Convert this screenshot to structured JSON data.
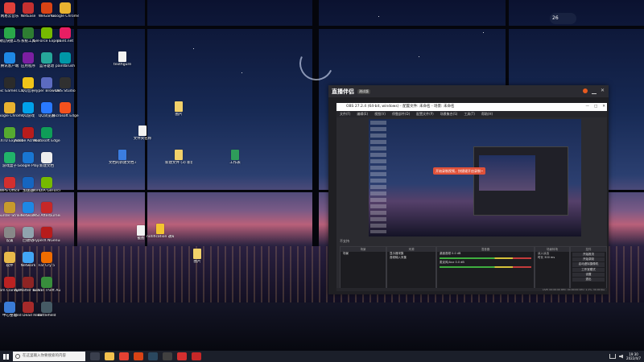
{
  "desktop": {
    "icons_col1": [
      {
        "label": "网易云音乐",
        "color": "#e0403a"
      },
      {
        "label": "微信快捷工作",
        "color": "#2aa84a"
      },
      {
        "label": "腾讯客户端",
        "color": "#1e88e5"
      },
      {
        "label": "Epic Games Launcher",
        "color": "#2b2b2b"
      },
      {
        "label": "Google Chrome",
        "color": "#e8b230"
      },
      {
        "label": "TEXTU Explorer",
        "color": "#55aa30"
      },
      {
        "label": "游戏盒子",
        "color": "#21b36a"
      },
      {
        "label": "WPS Office",
        "color": "#d32f2f"
      },
      {
        "label": "Counter-Strike Global Off...",
        "color": "#c79a2d"
      },
      {
        "label": "设置",
        "color": "#888888"
      },
      {
        "label": "软件",
        "color": "#e8b94a"
      },
      {
        "label": "Tom Clancy's",
        "color": "#b22"
      },
      {
        "label": "中心整理",
        "color": "#3a7bd5"
      }
    ],
    "icons_col2": [
      {
        "label": "NetEase",
        "color": "#c53030"
      },
      {
        "label": "系统工具",
        "color": "#2e7d32"
      },
      {
        "label": "应用程序",
        "color": "#7b1fa2"
      },
      {
        "label": "QQ音乐",
        "color": "#f0c419"
      },
      {
        "label": "QQ游戏",
        "color": "#00a0e9"
      },
      {
        "label": "Adobe Acrobat DC",
        "color": "#b71c1c"
      },
      {
        "label": "Google Play",
        "color": "#1976d2"
      },
      {
        "label": "加速器",
        "color": "#1565c0"
      },
      {
        "label": "Network",
        "color": "#1e88e5"
      },
      {
        "label": "回收站",
        "color": "#90a4ae"
      },
      {
        "label": "Network",
        "color": "#42a5f5"
      },
      {
        "label": "NoMatter BLADERO...",
        "color": "#8e2424"
      },
      {
        "label": "Red Dead Redemptio...",
        "color": "#a52a2a"
      }
    ],
    "icons_col3": [
      {
        "label": "WeGame",
        "color": "#d84315"
      },
      {
        "label": "GeForce Experience",
        "color": "#76b900"
      },
      {
        "label": "蓝牙驱动",
        "color": "#26a69a"
      },
      {
        "label": "Hyper Browser",
        "color": "#5c6bc0"
      },
      {
        "label": "QQ浏览器",
        "color": "#2979ff"
      },
      {
        "label": "Microsoft Edge",
        "color": "#0f9d58"
      },
      {
        "label": "新建文档",
        "color": "#eeeeee"
      },
      {
        "label": "NVIDIA GeForce",
        "color": "#76b900"
      },
      {
        "label": "MSI Afterburner",
        "color": "#c62828"
      },
      {
        "label": "HyperX NGenuity",
        "color": "#b71c1c"
      },
      {
        "label": "Far Cry 5",
        "color": "#ef6c00"
      },
      {
        "label": "Grand Theft Auto V",
        "color": "#388e3c"
      },
      {
        "label": "Battlefield",
        "color": "#455a64"
      }
    ],
    "icons_col4": [
      {
        "label": "Google Chrome",
        "color": "#e8b230"
      },
      {
        "label": "paint.net",
        "color": "#e91e63"
      },
      {
        "label": "paintbrush",
        "color": "#0097a7"
      },
      {
        "label": "OBS Studio",
        "color": "#303030"
      },
      {
        "label": "Microsoft Edge",
        "color": "#f4511e"
      }
    ],
    "files": [
      {
        "label": "textfigure",
        "color": "#f2f2f2"
      },
      {
        "label": "图片",
        "color": "#f2d16a"
      },
      {
        "label": "文件夹名称",
        "color": "#f2f2f2"
      },
      {
        "label": "文档的新建文档.docx",
        "color": "#3b7de0"
      },
      {
        "label": "新建文件 (3) 新建文本",
        "color": "#f2d16a"
      },
      {
        "label": "工作表",
        "color": "#2e9c5a"
      },
      {
        "label": "截图",
        "color": "#f2f2f2"
      },
      {
        "label": "notification 通知",
        "color": "#f4c430"
      },
      {
        "label": "图片",
        "color": "#f2d16a"
      }
    ],
    "weather": "26"
  },
  "obs": {
    "app_logo": "直播伴侣",
    "version": "测试版",
    "window_title": "OBS 27.2.4 (64-bit, windows) - 配置文件: 未命名 - 场景: 未命名",
    "window_controls": [
      "—",
      "□",
      "✕"
    ],
    "menu": [
      "文件(F)",
      "编辑(E)",
      "视图(V)",
      "停靠部件(D)",
      "配置文件(P)",
      "场景集合(S)",
      "工具(T)",
      "帮助(H)"
    ],
    "toast": "开始录制视频，快捷键开启录制~",
    "scene_bar_label": "不支持",
    "docks": {
      "scenes": {
        "title": "场景",
        "items": [
          "场景"
        ]
      },
      "sources": {
        "title": "来源",
        "items": [
          "显示器采集",
          "音频输入采集"
        ]
      },
      "mixer": {
        "title": "混音器",
        "channels": [
          {
            "name": "桌面音频",
            "level": "0.0 dB"
          },
          {
            "name": "麦克风/Aux",
            "level": "0.0 dB"
          }
        ]
      },
      "transitions": {
        "title": "场景转场",
        "type": "淡入淡出",
        "duration_label": "时长",
        "duration": "300 ms"
      },
      "controls": {
        "title": "控件",
        "buttons": [
          "开始推流",
          "开始录制",
          "启动虚拟摄像机",
          "工作室模式",
          "设置",
          "退出"
        ]
      }
    },
    "status": "LIVE: 00:00:00  REC: 00:00:00  CPU: 1.1%, 30.00 fps"
  },
  "taskbar": {
    "search_placeholder": "在这里输入你要搜索的内容",
    "apps": [
      {
        "name": "task-view",
        "color": "#3a3f4d"
      },
      {
        "name": "file-explorer",
        "color": "#f2c14e"
      },
      {
        "name": "chrome",
        "color": "#e34133"
      },
      {
        "name": "wegame",
        "color": "#d84315"
      },
      {
        "name": "steam",
        "color": "#2a475e"
      },
      {
        "name": "obs",
        "color": "#404040"
      },
      {
        "name": "wps",
        "color": "#d32f2f"
      },
      {
        "name": "netease",
        "color": "#c62828"
      }
    ],
    "time": "19:30",
    "date": "2022/4/7"
  }
}
